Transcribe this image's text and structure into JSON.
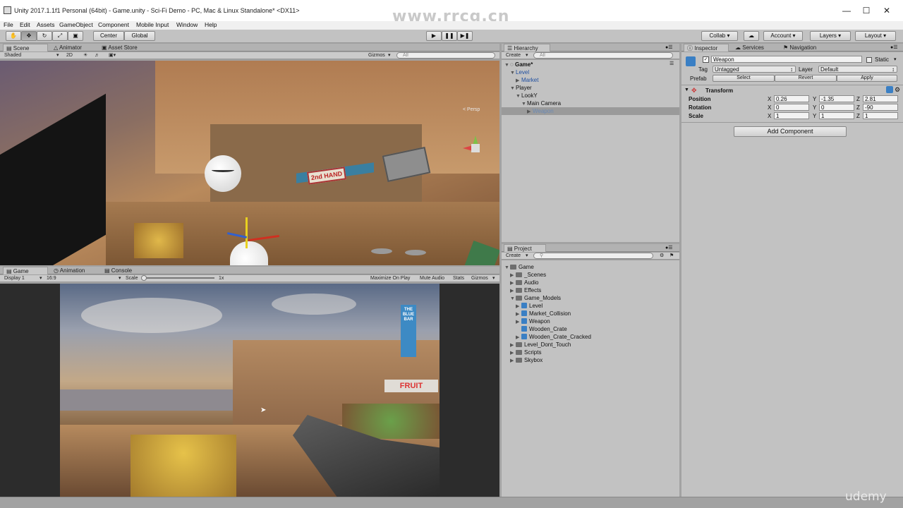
{
  "window": {
    "title": "Unity 2017.1.1f1 Personal (64bit) - Game.unity - Sci-Fi Demo - PC, Mac & Linux Standalone* <DX11>",
    "watermark": "www.rrcg.cn",
    "udemy": "udemy"
  },
  "menu": [
    "File",
    "Edit",
    "Assets",
    "GameObject",
    "Component",
    "Mobile Input",
    "Window",
    "Help"
  ],
  "toolbar": {
    "center": "Center",
    "global": "Global",
    "collab": "Collab",
    "account": "Account",
    "layers": "Layers",
    "layout": "Layout"
  },
  "scene": {
    "tabs": [
      "Scene",
      "Animator",
      "Asset Store"
    ],
    "shading": "Shaded",
    "mode2d": "2D",
    "gizmos": "Gizmos",
    "search": "All",
    "persp": "< Persp",
    "signs": {
      "hand": "2nd HAND"
    }
  },
  "game": {
    "tabs": [
      "Game",
      "Animation",
      "Console"
    ],
    "display": "Display 1",
    "aspect": "16:9",
    "scale_label": "Scale",
    "scale_value": "1x",
    "maximize": "Maximize On Play",
    "mute": "Mute Audio",
    "stats": "Stats",
    "gizmos": "Gizmos",
    "signs": {
      "bar": "THE BLUE BAR",
      "fruit": "FRUIT"
    }
  },
  "hierarchy": {
    "tab": "Hierarchy",
    "create": "Create",
    "search": "All",
    "items": [
      {
        "label": "Game*",
        "depth": 0,
        "arrow": "▼",
        "style": "bold"
      },
      {
        "label": "Level",
        "depth": 1,
        "arrow": "▼",
        "style": "blue"
      },
      {
        "label": "Market",
        "depth": 2,
        "arrow": "▶",
        "style": "blue"
      },
      {
        "label": "Player",
        "depth": 1,
        "arrow": "▼",
        "style": "normal"
      },
      {
        "label": "LookY",
        "depth": 2,
        "arrow": "▼",
        "style": "normal"
      },
      {
        "label": "Main Camera",
        "depth": 3,
        "arrow": "▼",
        "style": "normal"
      },
      {
        "label": "Weapon",
        "depth": 4,
        "arrow": "▶",
        "style": "selected"
      }
    ]
  },
  "project": {
    "tab": "Project",
    "create": "Create",
    "items": [
      {
        "label": "Game",
        "depth": 0,
        "arrow": "▼",
        "icon": "folder"
      },
      {
        "label": "_Scenes",
        "depth": 1,
        "arrow": "▶",
        "icon": "folder"
      },
      {
        "label": "Audio",
        "depth": 1,
        "arrow": "▶",
        "icon": "folder"
      },
      {
        "label": "Effects",
        "depth": 1,
        "arrow": "▶",
        "icon": "folder"
      },
      {
        "label": "Game_Models",
        "depth": 1,
        "arrow": "▼",
        "icon": "folder"
      },
      {
        "label": "Level",
        "depth": 2,
        "arrow": "▶",
        "icon": "cube"
      },
      {
        "label": "Market_Collision",
        "depth": 2,
        "arrow": "▶",
        "icon": "cube"
      },
      {
        "label": "Weapon",
        "depth": 2,
        "arrow": "▶",
        "icon": "cube"
      },
      {
        "label": "Wooden_Crate",
        "depth": 2,
        "arrow": "",
        "icon": "cube"
      },
      {
        "label": "Wooden_Crate_Cracked",
        "depth": 2,
        "arrow": "▶",
        "icon": "cube"
      },
      {
        "label": "Level_Dont_Touch",
        "depth": 1,
        "arrow": "▶",
        "icon": "folder"
      },
      {
        "label": "Scripts",
        "depth": 1,
        "arrow": "▶",
        "icon": "folder"
      },
      {
        "label": "Skybox",
        "depth": 1,
        "arrow": "▶",
        "icon": "folder"
      }
    ]
  },
  "inspector": {
    "tabs": [
      "Inspector",
      "Services",
      "Navigation"
    ],
    "object_name": "Weapon",
    "static": "Static",
    "tag_label": "Tag",
    "tag_value": "Untagged",
    "layer_label": "Layer",
    "layer_value": "Default",
    "prefab_label": "Prefab",
    "prefab_select": "Select",
    "prefab_revert": "Revert",
    "prefab_apply": "Apply",
    "transform_title": "Transform",
    "position_label": "Position",
    "rotation_label": "Rotation",
    "scale_label": "Scale",
    "axis": {
      "x": "X",
      "y": "Y",
      "z": "Z"
    },
    "position": {
      "x": "0.26",
      "y": "-1.35",
      "z": "2.81"
    },
    "rotation": {
      "x": "0",
      "y": "0",
      "z": "-90"
    },
    "scale": {
      "x": "1",
      "y": "1",
      "z": "1"
    },
    "add_component": "Add Component"
  }
}
